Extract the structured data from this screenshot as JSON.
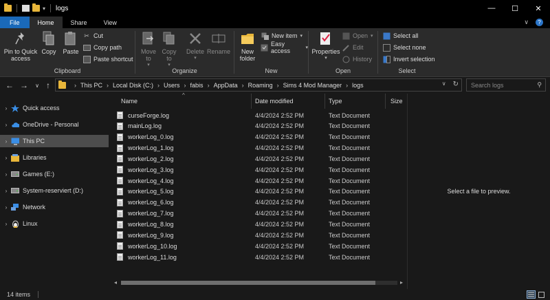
{
  "window": {
    "title": "logs",
    "minimize": "—",
    "maximize": "☐",
    "close": "✕"
  },
  "tabs": [
    {
      "label": "File"
    },
    {
      "label": "Home"
    },
    {
      "label": "Share"
    },
    {
      "label": "View"
    }
  ],
  "ribbon": {
    "clipboard": {
      "pin_to_quick_access": "Pin to Quick access",
      "copy": "Copy",
      "paste": "Paste",
      "cut": "Cut",
      "copy_path": "Copy path",
      "paste_shortcut": "Paste shortcut",
      "label": "Clipboard"
    },
    "organize": {
      "move_to": "Move to",
      "copy_to": "Copy to",
      "delete": "Delete",
      "rename": "Rename",
      "label": "Organize"
    },
    "new": {
      "new_folder": "New folder",
      "new_item": "New item",
      "easy_access": "Easy access",
      "label": "New"
    },
    "open": {
      "properties": "Properties",
      "open": "Open",
      "edit": "Edit",
      "history": "History",
      "label": "Open"
    },
    "select": {
      "select_all": "Select all",
      "select_none": "Select none",
      "invert_selection": "Invert selection",
      "label": "Select"
    }
  },
  "address": {
    "crumbs": [
      "This PC",
      "Local Disk (C:)",
      "Users",
      "fabis",
      "AppData",
      "Roaming",
      "Sims 4 Mod Manager",
      "logs"
    ]
  },
  "search": {
    "placeholder": "Search logs"
  },
  "nav": [
    {
      "label": "Quick access",
      "icon": "star-icon"
    },
    {
      "label": "OneDrive - Personal",
      "icon": "cloud-icon"
    },
    {
      "label": "This PC",
      "icon": "computer-icon",
      "selected": true
    },
    {
      "label": "Libraries",
      "icon": "libraries-icon"
    },
    {
      "label": "Games (E:)",
      "icon": "drive-icon"
    },
    {
      "label": "System-reserviert (D:)",
      "icon": "drive-icon"
    },
    {
      "label": "Network",
      "icon": "network-icon"
    },
    {
      "label": "Linux",
      "icon": "linux-icon"
    }
  ],
  "columns": {
    "name": "Name",
    "date": "Date modified",
    "type": "Type",
    "size": "Size"
  },
  "files": [
    {
      "name": "curseForge.log",
      "date": "4/4/2024 2:52 PM",
      "type": "Text Document"
    },
    {
      "name": "mainLog.log",
      "date": "4/4/2024 2:52 PM",
      "type": "Text Document"
    },
    {
      "name": "workerLog_0.log",
      "date": "4/4/2024 2:52 PM",
      "type": "Text Document"
    },
    {
      "name": "workerLog_1.log",
      "date": "4/4/2024 2:52 PM",
      "type": "Text Document"
    },
    {
      "name": "workerLog_2.log",
      "date": "4/4/2024 2:52 PM",
      "type": "Text Document"
    },
    {
      "name": "workerLog_3.log",
      "date": "4/4/2024 2:52 PM",
      "type": "Text Document"
    },
    {
      "name": "workerLog_4.log",
      "date": "4/4/2024 2:52 PM",
      "type": "Text Document"
    },
    {
      "name": "workerLog_5.log",
      "date": "4/4/2024 2:52 PM",
      "type": "Text Document"
    },
    {
      "name": "workerLog_6.log",
      "date": "4/4/2024 2:52 PM",
      "type": "Text Document"
    },
    {
      "name": "workerLog_7.log",
      "date": "4/4/2024 2:52 PM",
      "type": "Text Document"
    },
    {
      "name": "workerLog_8.log",
      "date": "4/4/2024 2:52 PM",
      "type": "Text Document"
    },
    {
      "name": "workerLog_9.log",
      "date": "4/4/2024 2:52 PM",
      "type": "Text Document"
    },
    {
      "name": "workerLog_10.log",
      "date": "4/4/2024 2:52 PM",
      "type": "Text Document"
    },
    {
      "name": "workerLog_11.log",
      "date": "4/4/2024 2:52 PM",
      "type": "Text Document"
    }
  ],
  "preview": {
    "message": "Select a file to preview."
  },
  "status": {
    "item_count": "14 items"
  },
  "colors": {
    "file_tab": "#1a69b9",
    "folder": "#e8b63a",
    "selection": "#4d4d4d"
  }
}
